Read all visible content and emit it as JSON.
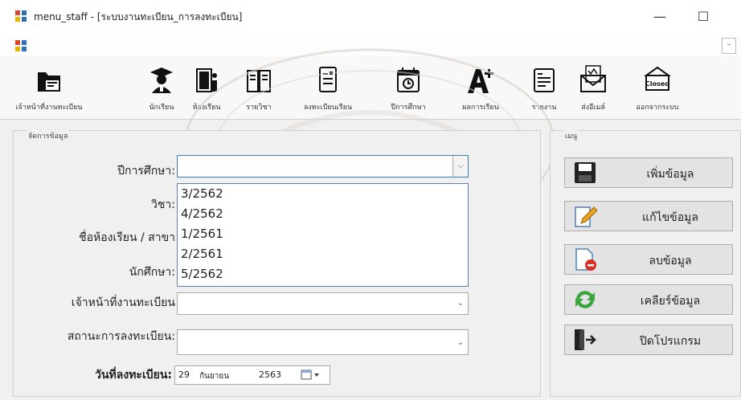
{
  "window": {
    "title": "menu_staff - [ระบบงานทะเบียน_การลงทะเบียน]",
    "minimize_glyph": "—",
    "maximize_glyph": "☐",
    "mdi_minimize_glyph": "–"
  },
  "toolbar": {
    "items": [
      {
        "label": "เจ้าหน้าที่งานทะเบียน",
        "icon": "office-folder-icon"
      },
      {
        "label": "นักเรียน",
        "icon": "graduate-icon"
      },
      {
        "label": "ห้องเรียน",
        "icon": "classroom-door-icon"
      },
      {
        "label": "รายวิชา",
        "icon": "book-icon"
      },
      {
        "label": "ลงทะเบียนเรียน",
        "icon": "register-form-icon"
      },
      {
        "label": "ปีการศึกษา",
        "icon": "calendar-clock-icon"
      },
      {
        "label": "ผลการเรียน",
        "icon": "grade-a-plus-icon"
      },
      {
        "label": "รายงาน",
        "icon": "report-icon"
      },
      {
        "label": "ส่งอีเมล์",
        "icon": "email-icon"
      },
      {
        "label": "ออกจากระบบ",
        "icon": "closed-sign-icon",
        "badge": "Closed"
      }
    ]
  },
  "form": {
    "group_title": "จัดการข้อมูล",
    "fields": {
      "academic_year": {
        "label": "ปีการศึกษา:",
        "value": ""
      },
      "subject": {
        "label": "วิชา:"
      },
      "classroom": {
        "label": "ชื่อห้องเรียน / สาขา"
      },
      "student": {
        "label": "นักศึกษา:"
      },
      "staff": {
        "label": "เจ้าหน้าที่งานทะเบียน",
        "value": ""
      },
      "status": {
        "label": "สถานะการลงทะเบียน:",
        "value": ""
      },
      "date": {
        "label": "วันที่ลงทะเบียน:",
        "day": "29",
        "month": "กันยายน",
        "year": "2563"
      }
    },
    "academic_year_options": [
      "3/2562",
      "4/2562",
      "1/2561",
      "2/2561",
      "5/2562"
    ]
  },
  "menu": {
    "group_title": "เมนู",
    "buttons": [
      {
        "label": "เพิ่มข้อมูล",
        "icon": "save-disk-icon"
      },
      {
        "label": "แก้ไขข้อมูล",
        "icon": "edit-pencil-icon"
      },
      {
        "label": "ลบข้อมูล",
        "icon": "delete-document-icon"
      },
      {
        "label": "เคลียร์ข้อมูล",
        "icon": "refresh-icon"
      },
      {
        "label": "ปิดโปรแกรม",
        "icon": "exit-door-icon"
      }
    ]
  },
  "colors": {
    "accent_border": "#3c7fb1",
    "dropdown_border": "#5d7fae",
    "app_icon_red": "#d9442f",
    "app_icon_blue": "#2c6fbf",
    "delete_red": "#d93025",
    "refresh_green": "#3aa53a"
  }
}
